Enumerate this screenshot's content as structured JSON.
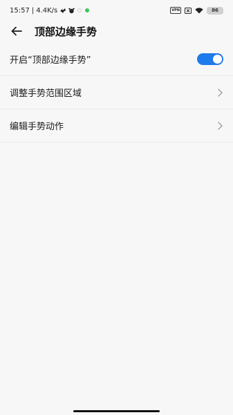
{
  "status_bar": {
    "time": "15:57",
    "separator": "|",
    "speed": "4.4K/s",
    "vpn": "VPN",
    "battery": "86"
  },
  "header": {
    "title": "顶部边缘手势"
  },
  "settings": {
    "items": [
      {
        "label": "开启“顶部边缘手势”",
        "control": "toggle",
        "enabled": true
      },
      {
        "label": "调整手势范围区域",
        "control": "chevron"
      },
      {
        "label": "编辑手势动作",
        "control": "chevron"
      }
    ]
  },
  "colors": {
    "accent": "#1f7aec",
    "background": "#f7f7f7",
    "divider": "#e9e9e9",
    "chevron": "#9a9a9a",
    "notification_dot": "#3cc85a"
  }
}
